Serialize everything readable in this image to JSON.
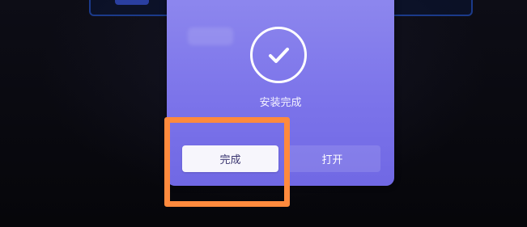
{
  "dialog": {
    "status_text": "安装完成",
    "status_icon": "check-icon",
    "done_label": "完成",
    "open_label": "打开"
  },
  "colors": {
    "dialog_bg": "#7c74ea",
    "highlight": "#ff8a3d",
    "primary_button_bg": "#f7f6fc"
  }
}
